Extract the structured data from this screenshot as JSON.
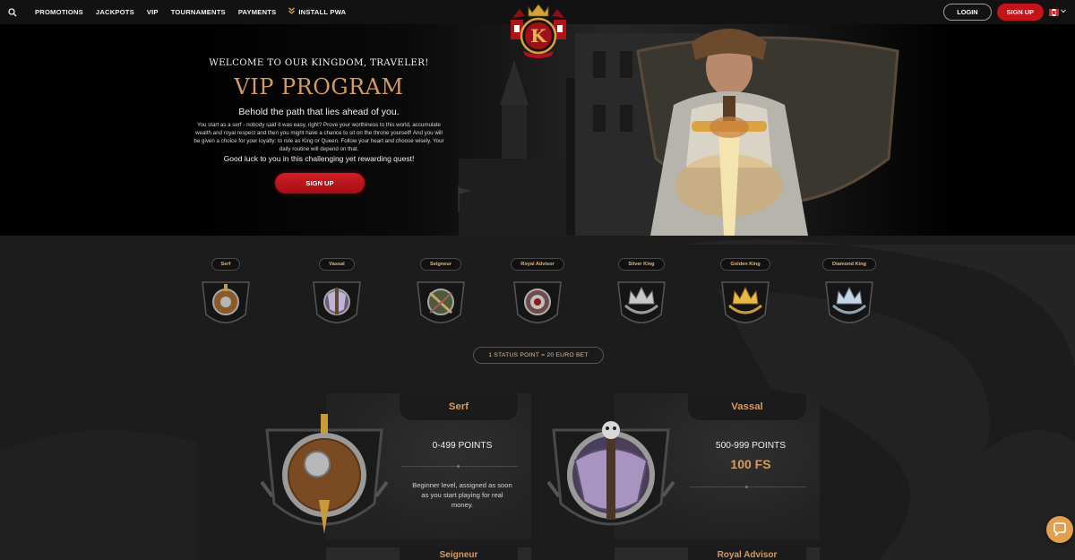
{
  "nav": {
    "items": [
      {
        "label": "PROMOTIONS"
      },
      {
        "label": "JACKPOTS"
      },
      {
        "label": "VIP"
      },
      {
        "label": "TOURNAMENTS"
      },
      {
        "label": "PAYMENTS"
      },
      {
        "label": "INSTALL PWA"
      }
    ],
    "active": "VIP",
    "icons": {
      "search": "search-icon",
      "pwa": "double-chevron-down-icon"
    }
  },
  "header": {
    "login_label": "LOGIN",
    "signup_label": "SIGN UP",
    "language_flag": "canada-flag-icon",
    "logo_letter": "K"
  },
  "hero": {
    "welcome": "WELCOME TO OUR KINGDOM, TRAVELER!",
    "title": "VIP PROGRAM",
    "subtitle": "Behold the path that lies ahead of you.",
    "description": "You start as a serf - nobody said it was easy, right? Prove your worthiness to this world, accumulate wealth and royal respect and then you might have a chance to sit on the throne yourself! And you will be given a choice for your loyalty: to rule as King or Queen. Follow your heart and choose wisely. Your daily routine will depend on that.",
    "goodluck": "Good luck to you in this challenging yet rewarding quest!",
    "signup_label": "SIGN UP"
  },
  "levels": [
    {
      "name": "Serf",
      "icon": "shield-sword-icon"
    },
    {
      "name": "Vassal",
      "icon": "skull-axe-icon"
    },
    {
      "name": "Seigneur",
      "icon": "crossbow-icon"
    },
    {
      "name": "Royal Advisor",
      "icon": "medallion-icon"
    },
    {
      "name": "Silver King",
      "icon": "silver-crown-icon"
    },
    {
      "name": "Golden King",
      "icon": "golden-crown-icon"
    },
    {
      "name": "Diamond King",
      "icon": "diamond-crown-icon"
    }
  ],
  "status_point": "1 STATUS POINT = 20 EURO BET",
  "cards": [
    {
      "name": "Serf",
      "points": "0-499 POINTS",
      "description": "Beginner level, assigned as soon as you start playing for real money."
    },
    {
      "name": "Vassal",
      "points": "500-999 POINTS",
      "reward": "100 FS"
    },
    {
      "name": "Seigneur"
    },
    {
      "name": "Royal Advisor"
    }
  ],
  "colors": {
    "accent": "#d79b61",
    "brand_red": "#c4131a",
    "background": "#1b1b1b"
  },
  "chat": {
    "icon": "chat-bubble-icon"
  }
}
